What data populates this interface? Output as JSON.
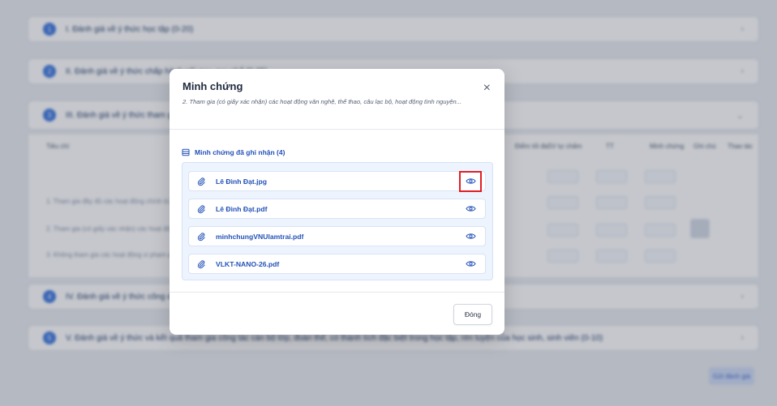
{
  "background": {
    "sections": [
      {
        "num": "1",
        "title": "I. Đánh giá về ý thức học tập (0-20)"
      },
      {
        "num": "2",
        "title": "II. Đánh giá về ý thức chấp hành nội quy, quy chế (0-25)"
      },
      {
        "num": "3",
        "title": "III. Đánh giá về ý thức tham gia hoạt động chính trị, xã hội (0-20)"
      },
      {
        "num": "4",
        "title": "IV. Đánh giá về ý thức công dân trong quan hệ cộng đồng (0-25)"
      },
      {
        "num": "5",
        "title": "V. Đánh giá về ý thức và kết quả tham gia công tác cán bộ lớp, đoàn thể, có thành tích đặc biệt trong học tập, rèn luyện của học sinh, sinh viên (0-10)"
      }
    ],
    "table_headers": [
      "Tiêu chí",
      "Điểm tối đa",
      "SV tự chấm",
      "TT",
      "Minh chứng",
      "Ghi chú",
      "Thao tác"
    ],
    "rows": [
      "1. Tham gia đầy đủ các hoạt động chính trị, xã hội",
      "2. Tham gia (có giấy xác nhận) các hoạt động văn nghệ",
      "3. Không tham gia các hoạt động vi phạm pháp luật"
    ],
    "submit_label": "Gửi đánh giá"
  },
  "modal": {
    "title": "Minh chứng",
    "subtitle": "2. Tham gia (có giấy xác nhận) các hoạt động văn nghệ, thể thao, câu lạc bộ, hoạt động tình nguyện...",
    "close_symbol": "×",
    "section_label": "Minh chứng đã ghi nhận (4)",
    "files": [
      {
        "name": "Lê Đình Đạt.jpg",
        "highlighted": true
      },
      {
        "name": "Lê Đình Đạt.pdf",
        "highlighted": false
      },
      {
        "name": "minhchungVNUlamtrai.pdf",
        "highlighted": false
      },
      {
        "name": "VLKT-NANO-26.pdf",
        "highlighted": false
      }
    ],
    "close_button": "Đóng"
  },
  "colors": {
    "accent": "#2251b8",
    "highlight": "#e01e26",
    "list_bg": "#eef4fd"
  },
  "icons": {
    "section": "document-stack-icon",
    "file": "paperclip-icon",
    "view": "eye-icon",
    "close": "close-icon"
  }
}
